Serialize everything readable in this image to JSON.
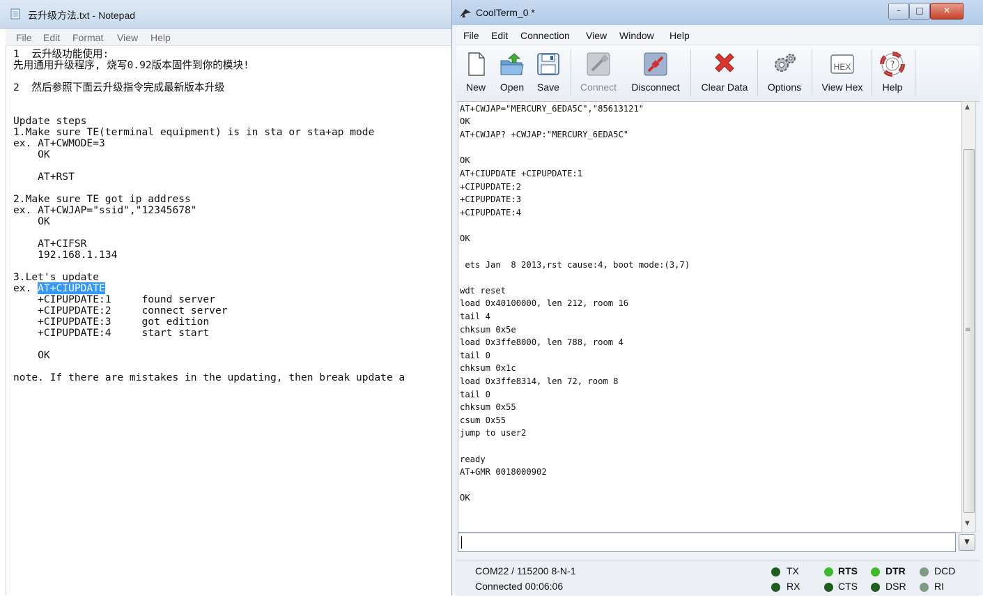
{
  "notepad": {
    "title": "云升级方法.txt - Notepad",
    "menu": [
      "File",
      "Edit",
      "Format",
      "View",
      "Help"
    ],
    "lines": [
      "1  云升级功能使用:",
      "先用通用升级程序, 烧写0.92版本固件到你的模块!",
      "",
      "2  然后参照下面云升级指令完成最新版本升级",
      "",
      "",
      "Update steps",
      "1.Make sure TE(terminal equipment) is in sta or sta+ap mode",
      "ex. AT+CWMODE=3",
      "    OK",
      "",
      "    AT+RST",
      "",
      "2.Make sure TE got ip address",
      "ex. AT+CWJAP=\"ssid\",\"12345678\"",
      "    OK",
      "",
      "    AT+CIFSR",
      "    192.168.1.134",
      "",
      "3.Let's update",
      "ex. ",
      "    +CIPUPDATE:1     found server",
      "    +CIPUPDATE:2     connect server",
      "    +CIPUPDATE:3     got edition",
      "    +CIPUPDATE:4     start start",
      "",
      "    OK",
      "",
      "note. If there are mistakes in the updating, then break update a"
    ],
    "selected_text": "AT+CIUPDATE"
  },
  "coolterm": {
    "title": "CoolTerm_0 *",
    "window_buttons": {
      "minimize": "–",
      "maximize": "□",
      "close": "✕"
    },
    "menu": [
      "File",
      "Edit",
      "Connection",
      "View",
      "Window",
      "Help"
    ],
    "toolbar": {
      "new": "New",
      "open": "Open",
      "save": "Save",
      "connect": "Connect",
      "disconnect": "Disconnect",
      "clear_data": "Clear Data",
      "options": "Options",
      "view_hex": "View Hex",
      "help": "Help",
      "hex_icon_text": "HEX"
    },
    "terminal_lines": [
      "AT+CWJAP=\"MERCURY_6EDA5C\",\"85613121\"",
      "OK",
      "AT+CWJAP? +CWJAP:\"MERCURY_6EDA5C\"",
      "",
      "OK",
      "AT+CIUPDATE +CIPUPDATE:1",
      "+CIPUPDATE:2",
      "+CIPUPDATE:3",
      "+CIPUPDATE:4",
      "",
      "OK",
      "",
      " ets Jan  8 2013,rst cause:4, boot mode:(3,7)",
      "",
      "wdt reset",
      "load 0x40100000, len 212, room 16",
      "tail 4",
      "chksum 0x5e",
      "load 0x3ffe8000, len 788, room 4",
      "tail 0",
      "chksum 0x1c",
      "load 0x3ffe8314, len 72, room 8",
      "tail 0",
      "chksum 0x55",
      "csum 0x55",
      "jump to user2",
      "",
      "ready",
      "AT+GMR 0018000902",
      "",
      "OK"
    ],
    "input_value": "",
    "status": {
      "port": "COM22 / 115200 8-N-1",
      "connected": "Connected 00:06:06"
    },
    "leds": {
      "tx": "TX",
      "rx": "RX",
      "rts": "RTS",
      "cts": "CTS",
      "dtr": "DTR",
      "dsr": "DSR",
      "dcd": "DCD",
      "ri": "RI"
    },
    "colors": {
      "led_dark": "#1f5e1f",
      "led_on": "#3dbb2b",
      "led_gray": "#7d9c84"
    }
  }
}
